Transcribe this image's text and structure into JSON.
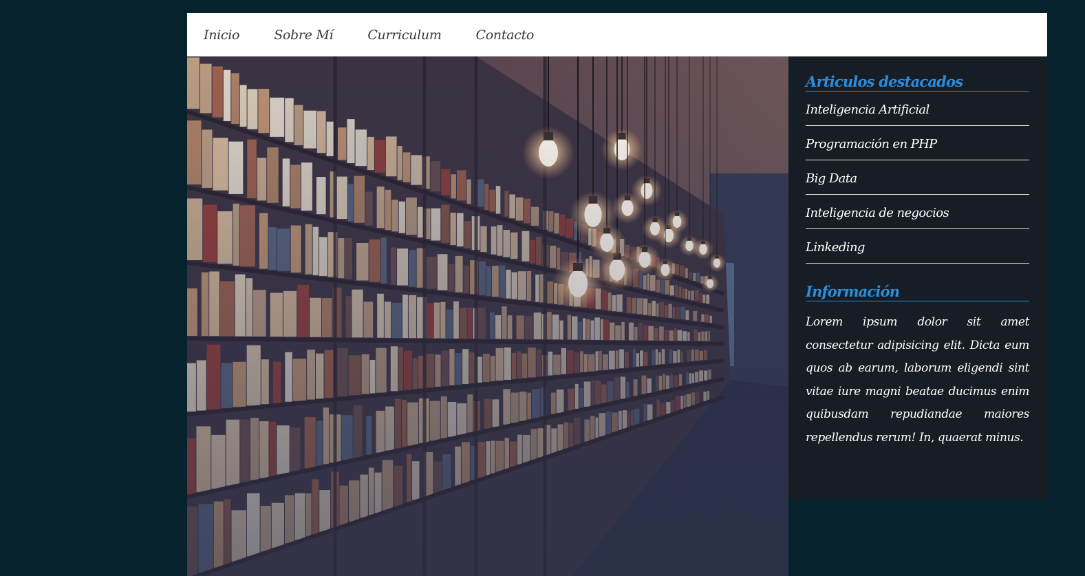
{
  "nav": {
    "items": [
      {
        "label": "Inicio"
      },
      {
        "label": "Sobre Mí"
      },
      {
        "label": "Curriculum"
      },
      {
        "label": "Contacto"
      }
    ]
  },
  "hero": {
    "image": "library-bookshelves-hanging-bulbs-photo"
  },
  "sidebar": {
    "featured_title": "Articulos destacados",
    "articles": [
      {
        "label": "Inteligencia Artificial"
      },
      {
        "label": "Programación en PHP"
      },
      {
        "label": "Big Data"
      },
      {
        "label": "Inteligencia de negocios"
      },
      {
        "label": "Linkeding"
      }
    ],
    "info_title": "Información",
    "info_text": "Lorem ipsum dolor sit amet consectetur adipisicing elit. Dicta eum quos ab earum, laborum eligendi sint vitae iure magni beatae ducimus enim quibusdam repudiandae maiores repellendus rerum! In, quaerat minus."
  },
  "colors": {
    "page_background": "#06232d",
    "navbar_background": "#ffffff",
    "sidebar_background": "#171d24",
    "accent": "#2a8ee0"
  }
}
